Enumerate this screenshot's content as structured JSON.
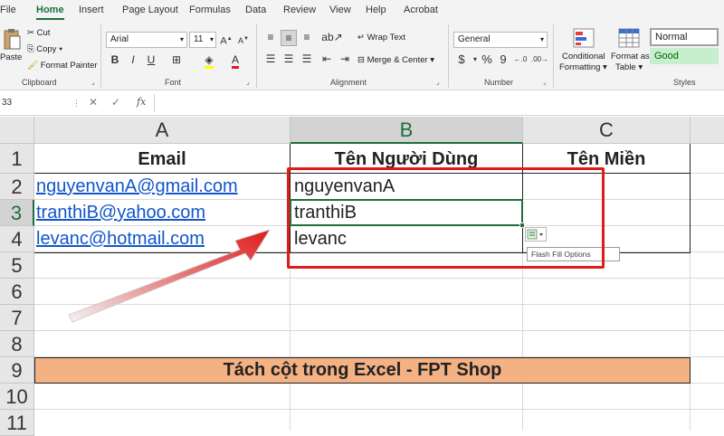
{
  "ribbon": {
    "tabs": [
      "File",
      "Home",
      "Insert",
      "Page Layout",
      "Formulas",
      "Data",
      "Review",
      "View",
      "Help",
      "Acrobat"
    ],
    "clipboard": {
      "paste": "Paste",
      "cut": "Cut",
      "copy": "Copy",
      "format_painter": "Format Painter",
      "label": "Clipboard"
    },
    "font": {
      "name": "Arial",
      "size": "11",
      "label": "Font"
    },
    "alignment": {
      "wrap_text": "Wrap Text",
      "merge_center": "Merge & Center",
      "label": "Alignment"
    },
    "number": {
      "format": "General",
      "label": "Number",
      "currency": "$",
      "percent": "%",
      "comma": "9"
    },
    "styles": {
      "conditional_1": "Conditional",
      "conditional_2": "Formatting",
      "format_as_1": "Format as",
      "format_as_2": "Table",
      "normal": "Normal",
      "good": "Good",
      "label": "Styles"
    }
  },
  "formula_bar": {
    "name_box": "33",
    "fx": "fx"
  },
  "columns": [
    "A",
    "B",
    "C"
  ],
  "rows": [
    "1",
    "2",
    "3",
    "4",
    "5",
    "6",
    "7",
    "8",
    "9",
    "10",
    "11"
  ],
  "sheet": {
    "a1": "Email",
    "b1": "Tên Người Dùng",
    "c1": "Tên Miền",
    "a2": "nguyenvanA@gmail.com",
    "a3": "tranthiB@yahoo.com",
    "a4": "levanc@hotmail.com",
    "b2": "nguyenvanA",
    "b3": "tranthiB",
    "b4": "levanc",
    "banner": "Tách cột trong Excel - FPT Shop"
  },
  "flash_fill_tooltip": "Flash Fill Options",
  "colors": {
    "header_green": "#1e6e3e",
    "banner": "#f4b183",
    "highlight_red": "#e01b1b",
    "link": "#1155cc"
  }
}
